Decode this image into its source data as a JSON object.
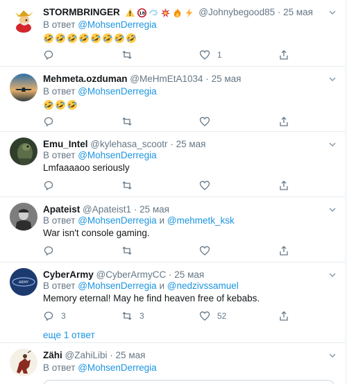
{
  "ui": {
    "reply_prefix": "В ответ",
    "and_word": "и",
    "show_more": "еще 1 ответ"
  },
  "colors": {
    "link": "#1b95e0",
    "muted": "#657786",
    "text": "#14171a",
    "divider": "#e6ecf0"
  },
  "tweets": [
    {
      "name": "STORMBRINGER",
      "name_badges": [
        "warning-emoji",
        "18-plus-emoji",
        "dizzy-emoji",
        "collision-emoji",
        "fire-emoji",
        "lightning-emoji"
      ],
      "handle": "@Johnybegood85",
      "date": "25 мая",
      "reply_to": [
        "@MohsenDerregia"
      ],
      "text": "",
      "text_emoji": "rolling-on-floor-laughing-emoji",
      "text_emoji_count": 8,
      "counts": {
        "reply": "",
        "retweet": "",
        "like": "1"
      }
    },
    {
      "name": "Mehmeta.ozduman",
      "handle": "@MeHmEtA1034",
      "date": "25 мая",
      "reply_to": [
        "@MohsenDerregia"
      ],
      "text": "",
      "text_emoji": "rolling-on-floor-laughing-emoji",
      "text_emoji_count": 3,
      "counts": {
        "reply": "",
        "retweet": "",
        "like": ""
      }
    },
    {
      "name": "Emu_Intel",
      "handle": "@kylehasa_scootr",
      "date": "25 мая",
      "reply_to": [
        "@MohsenDerregia"
      ],
      "text": "Lmfaaaaoo seriously",
      "counts": {
        "reply": "",
        "retweet": "",
        "like": ""
      }
    },
    {
      "name": "Apateist",
      "handle": "@Apateist1",
      "date": "25 мая",
      "reply_to": [
        "@MohsenDerregia",
        "@mehmetk_ksk"
      ],
      "text": "War isn't console gaming.",
      "counts": {
        "reply": "",
        "retweet": "",
        "like": ""
      }
    },
    {
      "name": "CyberArmy",
      "handle": "@CyberArmyCC",
      "date": "25 мая",
      "reply_to": [
        "@MohsenDerregia",
        "@nedzivssamuel"
      ],
      "text": "Memory eternal! May he find heaven free of kebabs.",
      "counts": {
        "reply": "3",
        "retweet": "3",
        "like": "52"
      }
    },
    {
      "name": "Zähi",
      "handle": "@ZahiLibi",
      "date": "25 мая",
      "reply_to": [
        "@MohsenDerregia"
      ],
      "text": ""
    }
  ]
}
